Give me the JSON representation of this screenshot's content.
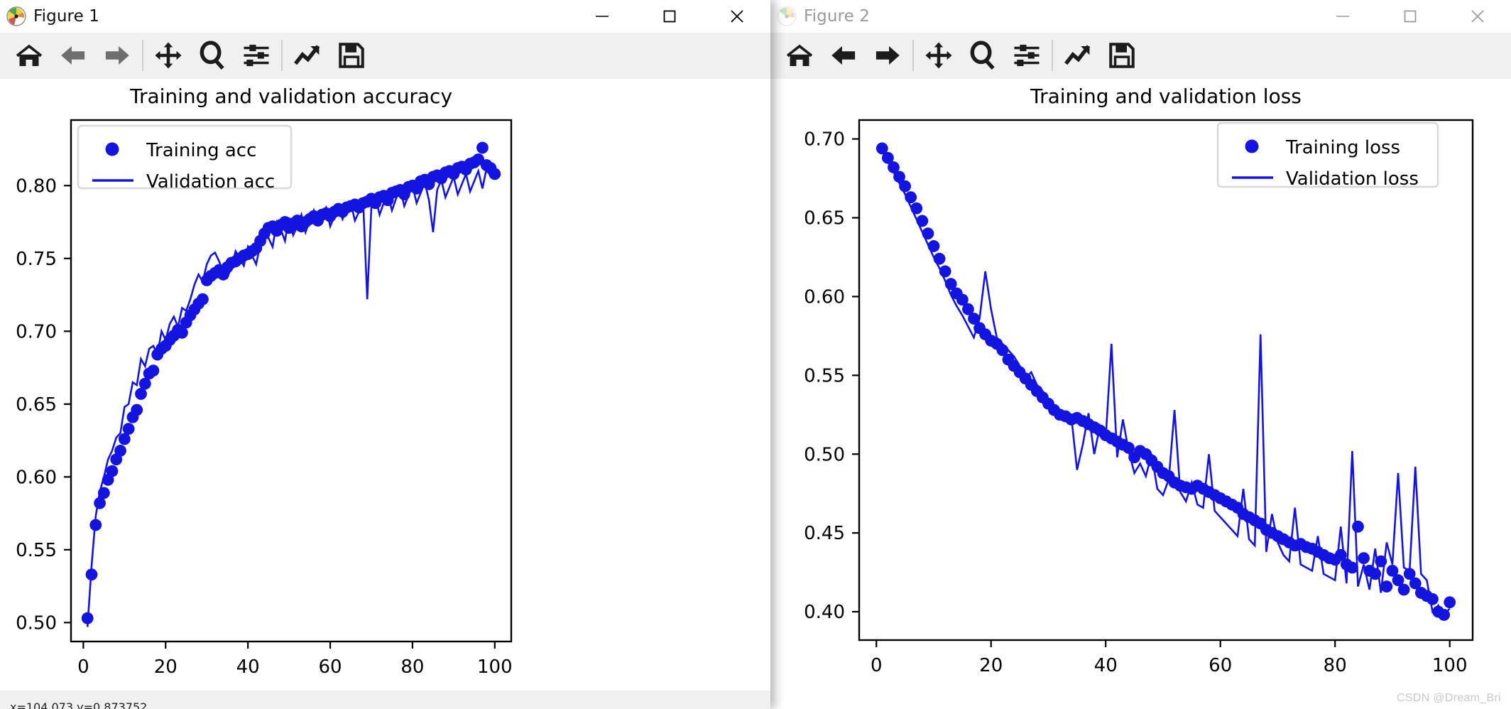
{
  "windows": [
    {
      "title": "Figure 1",
      "icon": "matplotlib-icon",
      "controls": {
        "minimize": "minimize-icon",
        "maximize": "maximize-icon",
        "close": "close-icon"
      },
      "toolbar": [
        {
          "name": "home-button",
          "label": "Home"
        },
        {
          "name": "back-button",
          "label": "Back"
        },
        {
          "name": "forward-button",
          "label": "Forward"
        },
        {
          "name": "pan-button",
          "label": "Pan"
        },
        {
          "name": "zoom-button",
          "label": "Zoom"
        },
        {
          "name": "configure-subplots-button",
          "label": "Configure subplots"
        },
        {
          "name": "edit-axis-button",
          "label": "Edit axis, curve and image parameters"
        },
        {
          "name": "save-button",
          "label": "Save the figure"
        }
      ],
      "statusbar": "x=104.073   y=0.873752"
    },
    {
      "title": "Figure 2",
      "icon": "matplotlib-icon",
      "controls": {
        "minimize": "minimize-icon",
        "maximize": "maximize-icon",
        "close": "close-icon"
      },
      "toolbar": [
        {
          "name": "home-button",
          "label": "Home"
        },
        {
          "name": "back-button",
          "label": "Back"
        },
        {
          "name": "forward-button",
          "label": "Forward"
        },
        {
          "name": "pan-button",
          "label": "Pan"
        },
        {
          "name": "zoom-button",
          "label": "Zoom"
        },
        {
          "name": "configure-subplots-button",
          "label": "Configure subplots"
        },
        {
          "name": "edit-axis-button",
          "label": "Edit axis, curve and image parameters"
        },
        {
          "name": "save-button",
          "label": "Save the figure"
        }
      ],
      "statusbar": ""
    }
  ],
  "watermark": "CSDN @Dream_Bri",
  "colors": {
    "series": "#1414e0",
    "axis": "#000000",
    "toolbar_bg": "#f0f0f0",
    "canvas_bg": "#ffffff"
  },
  "chart_data": [
    {
      "type": "scatter",
      "title": "Training and validation accuracy",
      "xlabel": "",
      "ylabel": "",
      "xlim": [
        -3,
        104
      ],
      "ylim": [
        0.487,
        0.845
      ],
      "xticks": [
        0,
        20,
        40,
        60,
        80,
        100
      ],
      "yticks": [
        0.5,
        0.55,
        0.6,
        0.65,
        0.7,
        0.75,
        0.8
      ],
      "xticklabels": [
        "0",
        "20",
        "40",
        "60",
        "80",
        "100"
      ],
      "yticklabels": [
        "0.50",
        "0.55",
        "0.60",
        "0.65",
        "0.70",
        "0.75",
        "0.80"
      ],
      "grid": false,
      "legend_position": "upper left",
      "legend": [
        {
          "label": "Training acc",
          "marker": "dot",
          "color": "#1414e0"
        },
        {
          "label": "Validation acc",
          "marker": "line",
          "color": "#1414e0"
        }
      ],
      "series": [
        {
          "name": "Training acc",
          "style": "dot",
          "color": "#1414e0",
          "x": [
            1,
            2,
            3,
            4,
            5,
            6,
            7,
            8,
            9,
            10,
            11,
            12,
            13,
            14,
            15,
            16,
            17,
            18,
            19,
            20,
            21,
            22,
            23,
            24,
            25,
            26,
            27,
            28,
            29,
            30,
            31,
            32,
            33,
            34,
            35,
            36,
            37,
            38,
            39,
            40,
            41,
            42,
            43,
            44,
            45,
            46,
            47,
            48,
            49,
            50,
            51,
            52,
            53,
            54,
            55,
            56,
            57,
            58,
            59,
            60,
            61,
            62,
            63,
            64,
            65,
            66,
            67,
            68,
            69,
            70,
            71,
            72,
            73,
            74,
            75,
            76,
            77,
            78,
            79,
            80,
            81,
            82,
            83,
            84,
            85,
            86,
            87,
            88,
            89,
            90,
            91,
            92,
            93,
            94,
            95,
            96,
            97,
            98,
            99,
            100
          ],
          "values": [
            0.503,
            0.533,
            0.567,
            0.582,
            0.589,
            0.598,
            0.604,
            0.612,
            0.618,
            0.626,
            0.633,
            0.641,
            0.646,
            0.657,
            0.664,
            0.671,
            0.673,
            0.684,
            0.688,
            0.69,
            0.694,
            0.697,
            0.701,
            0.699,
            0.706,
            0.711,
            0.715,
            0.719,
            0.722,
            0.735,
            0.738,
            0.74,
            0.742,
            0.739,
            0.744,
            0.747,
            0.748,
            0.75,
            0.752,
            0.753,
            0.755,
            0.757,
            0.762,
            0.767,
            0.771,
            0.772,
            0.769,
            0.773,
            0.775,
            0.771,
            0.774,
            0.776,
            0.772,
            0.775,
            0.777,
            0.779,
            0.776,
            0.78,
            0.781,
            0.779,
            0.782,
            0.784,
            0.782,
            0.785,
            0.786,
            0.787,
            0.785,
            0.788,
            0.789,
            0.791,
            0.788,
            0.792,
            0.793,
            0.79,
            0.795,
            0.796,
            0.797,
            0.794,
            0.799,
            0.8,
            0.798,
            0.803,
            0.804,
            0.801,
            0.806,
            0.807,
            0.805,
            0.809,
            0.81,
            0.808,
            0.812,
            0.813,
            0.811,
            0.815,
            0.816,
            0.818,
            0.826,
            0.814,
            0.812,
            0.808
          ]
        },
        {
          "name": "Validation acc",
          "style": "line",
          "color": "#1414e0",
          "x": [
            1,
            2,
            3,
            4,
            5,
            6,
            7,
            8,
            9,
            10,
            11,
            12,
            13,
            14,
            15,
            16,
            17,
            18,
            19,
            20,
            21,
            22,
            23,
            24,
            25,
            26,
            27,
            28,
            29,
            30,
            31,
            32,
            33,
            34,
            35,
            36,
            37,
            38,
            39,
            40,
            41,
            42,
            43,
            44,
            45,
            46,
            47,
            48,
            49,
            50,
            51,
            52,
            53,
            54,
            55,
            56,
            57,
            58,
            59,
            60,
            61,
            62,
            63,
            64,
            65,
            66,
            67,
            68,
            69,
            70,
            71,
            72,
            73,
            74,
            75,
            76,
            77,
            78,
            79,
            80,
            81,
            82,
            83,
            84,
            85,
            86,
            87,
            88,
            89,
            90,
            91,
            92,
            93,
            94,
            95,
            96,
            97,
            98,
            99,
            100
          ],
          "values": [
            0.497,
            0.539,
            0.573,
            0.59,
            0.6,
            0.612,
            0.618,
            0.627,
            0.63,
            0.648,
            0.65,
            0.665,
            0.663,
            0.681,
            0.676,
            0.688,
            0.69,
            0.684,
            0.7,
            0.694,
            0.705,
            0.71,
            0.703,
            0.716,
            0.714,
            0.722,
            0.732,
            0.739,
            0.734,
            0.746,
            0.752,
            0.754,
            0.748,
            0.741,
            0.737,
            0.744,
            0.755,
            0.75,
            0.745,
            0.758,
            0.752,
            0.746,
            0.76,
            0.772,
            0.764,
            0.758,
            0.775,
            0.77,
            0.762,
            0.778,
            0.766,
            0.772,
            0.78,
            0.768,
            0.776,
            0.783,
            0.774,
            0.781,
            0.785,
            0.772,
            0.779,
            0.786,
            0.777,
            0.784,
            0.788,
            0.776,
            0.782,
            0.79,
            0.722,
            0.785,
            0.792,
            0.78,
            0.788,
            0.795,
            0.783,
            0.791,
            0.798,
            0.786,
            0.793,
            0.8,
            0.788,
            0.795,
            0.802,
            0.79,
            0.768,
            0.797,
            0.804,
            0.792,
            0.799,
            0.806,
            0.794,
            0.801,
            0.808,
            0.796,
            0.803,
            0.81,
            0.798,
            0.812,
            0.806,
            0.808
          ]
        }
      ]
    },
    {
      "type": "scatter",
      "title": "Training and validation loss",
      "xlabel": "",
      "ylabel": "",
      "xlim": [
        -3,
        104
      ],
      "ylim": [
        0.382,
        0.712
      ],
      "xticks": [
        0,
        20,
        40,
        60,
        80,
        100
      ],
      "yticks": [
        0.4,
        0.45,
        0.5,
        0.55,
        0.6,
        0.65,
        0.7
      ],
      "xticklabels": [
        "0",
        "20",
        "40",
        "60",
        "80",
        "100"
      ],
      "yticklabels": [
        "0.40",
        "0.45",
        "0.50",
        "0.55",
        "0.60",
        "0.65",
        "0.70"
      ],
      "grid": false,
      "legend_position": "upper right",
      "legend": [
        {
          "label": "Training loss",
          "marker": "dot",
          "color": "#1414e0"
        },
        {
          "label": "Validation loss",
          "marker": "line",
          "color": "#1414e0"
        }
      ],
      "series": [
        {
          "name": "Training loss",
          "style": "dot",
          "color": "#1414e0",
          "x": [
            1,
            2,
            3,
            4,
            5,
            6,
            7,
            8,
            9,
            10,
            11,
            12,
            13,
            14,
            15,
            16,
            17,
            18,
            19,
            20,
            21,
            22,
            23,
            24,
            25,
            26,
            27,
            28,
            29,
            30,
            31,
            32,
            33,
            34,
            35,
            36,
            37,
            38,
            39,
            40,
            41,
            42,
            43,
            44,
            45,
            46,
            47,
            48,
            49,
            50,
            51,
            52,
            53,
            54,
            55,
            56,
            57,
            58,
            59,
            60,
            61,
            62,
            63,
            64,
            65,
            66,
            67,
            68,
            69,
            70,
            71,
            72,
            73,
            74,
            75,
            76,
            77,
            78,
            79,
            80,
            81,
            82,
            83,
            84,
            85,
            86,
            87,
            88,
            89,
            90,
            91,
            92,
            93,
            94,
            95,
            96,
            97,
            98,
            99,
            100
          ],
          "values": [
            0.694,
            0.688,
            0.682,
            0.676,
            0.67,
            0.663,
            0.656,
            0.648,
            0.64,
            0.632,
            0.624,
            0.616,
            0.608,
            0.602,
            0.598,
            0.592,
            0.586,
            0.58,
            0.576,
            0.572,
            0.57,
            0.566,
            0.56,
            0.556,
            0.552,
            0.548,
            0.544,
            0.54,
            0.536,
            0.532,
            0.528,
            0.525,
            0.524,
            0.522,
            0.523,
            0.521,
            0.519,
            0.517,
            0.515,
            0.512,
            0.51,
            0.508,
            0.506,
            0.504,
            0.498,
            0.502,
            0.5,
            0.496,
            0.492,
            0.488,
            0.486,
            0.482,
            0.48,
            0.479,
            0.478,
            0.48,
            0.478,
            0.476,
            0.474,
            0.472,
            0.47,
            0.468,
            0.466,
            0.462,
            0.46,
            0.458,
            0.456,
            0.452,
            0.45,
            0.448,
            0.446,
            0.444,
            0.442,
            0.443,
            0.441,
            0.44,
            0.438,
            0.436,
            0.434,
            0.433,
            0.436,
            0.43,
            0.428,
            0.454,
            0.434,
            0.426,
            0.424,
            0.432,
            0.416,
            0.426,
            0.42,
            0.414,
            0.424,
            0.418,
            0.412,
            0.41,
            0.408,
            0.4,
            0.398,
            0.406
          ]
        },
        {
          "name": "Validation loss",
          "style": "line",
          "color": "#1414e0",
          "x": [
            1,
            2,
            3,
            4,
            5,
            6,
            7,
            8,
            9,
            10,
            11,
            12,
            13,
            14,
            15,
            16,
            17,
            18,
            19,
            20,
            21,
            22,
            23,
            24,
            25,
            26,
            27,
            28,
            29,
            30,
            31,
            32,
            33,
            34,
            35,
            36,
            37,
            38,
            39,
            40,
            41,
            42,
            43,
            44,
            45,
            46,
            47,
            48,
            49,
            50,
            51,
            52,
            53,
            54,
            55,
            56,
            57,
            58,
            59,
            60,
            61,
            62,
            63,
            64,
            65,
            66,
            67,
            68,
            69,
            70,
            71,
            72,
            73,
            74,
            75,
            76,
            77,
            78,
            79,
            80,
            81,
            82,
            83,
            84,
            85,
            86,
            87,
            88,
            89,
            90,
            91,
            92,
            93,
            94,
            95,
            96,
            97,
            98,
            99,
            100
          ],
          "values": [
            0.693,
            0.686,
            0.679,
            0.672,
            0.665,
            0.657,
            0.649,
            0.641,
            0.633,
            0.625,
            0.618,
            0.61,
            0.601,
            0.594,
            0.588,
            0.581,
            0.574,
            0.586,
            0.616,
            0.592,
            0.574,
            0.57,
            0.566,
            0.562,
            0.556,
            0.548,
            0.552,
            0.544,
            0.54,
            0.534,
            0.528,
            0.523,
            0.522,
            0.524,
            0.49,
            0.506,
            0.526,
            0.5,
            0.518,
            0.51,
            0.57,
            0.498,
            0.522,
            0.502,
            0.488,
            0.494,
            0.486,
            0.5,
            0.478,
            0.474,
            0.484,
            0.528,
            0.476,
            0.47,
            0.482,
            0.468,
            0.466,
            0.5,
            0.464,
            0.46,
            0.456,
            0.452,
            0.448,
            0.478,
            0.446,
            0.442,
            0.576,
            0.438,
            0.462,
            0.444,
            0.436,
            0.432,
            0.466,
            0.43,
            0.428,
            0.426,
            0.448,
            0.424,
            0.422,
            0.42,
            0.454,
            0.418,
            0.502,
            0.416,
            0.43,
            0.414,
            0.44,
            0.412,
            0.444,
            0.43,
            0.488,
            0.428,
            0.426,
            0.492,
            0.424,
            0.42,
            0.4,
            0.404,
            0.398,
            0.402
          ]
        }
      ]
    }
  ]
}
